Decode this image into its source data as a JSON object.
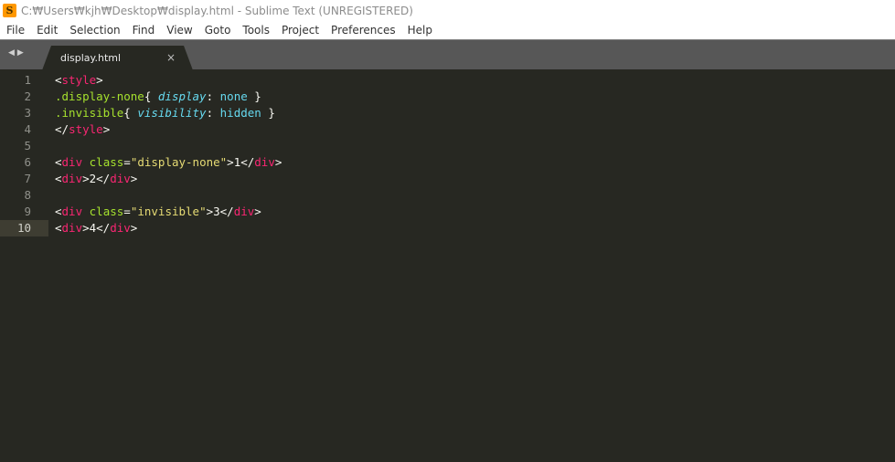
{
  "window": {
    "title": "C:₩Users₩kjh₩Desktop₩display.html - Sublime Text (UNREGISTERED)",
    "icon": "sublime-text-icon"
  },
  "menu": [
    "File",
    "Edit",
    "Selection",
    "Find",
    "View",
    "Goto",
    "Tools",
    "Project",
    "Preferences",
    "Help"
  ],
  "tabs": [
    {
      "label": "display.html",
      "close": "×",
      "active": true
    }
  ],
  "nav_arrows": "◀▶",
  "editor": {
    "active_line": 10,
    "colors": {
      "tag": "#f92672",
      "punct": "#f8f8f2",
      "attr": "#a6e22e",
      "string": "#e6db74",
      "property": "#66d9ef",
      "text": "#f8f8f2"
    },
    "lines": [
      {
        "n": "1",
        "tokens": [
          [
            "punct",
            "<"
          ],
          [
            "tag",
            "style"
          ],
          [
            "punct",
            ">"
          ]
        ]
      },
      {
        "n": "2",
        "tokens": [
          [
            "attr",
            ".display-none"
          ],
          [
            "punct",
            "{ "
          ],
          [
            "property-italic",
            "display"
          ],
          [
            "punct",
            ": "
          ],
          [
            "property",
            "none"
          ],
          [
            "punct",
            " }"
          ]
        ]
      },
      {
        "n": "3",
        "tokens": [
          [
            "attr",
            ".invisible"
          ],
          [
            "punct",
            "{ "
          ],
          [
            "property-italic",
            "visibility"
          ],
          [
            "punct",
            ": "
          ],
          [
            "property",
            "hidden"
          ],
          [
            "punct",
            " }"
          ]
        ]
      },
      {
        "n": "4",
        "tokens": [
          [
            "punct",
            "</"
          ],
          [
            "tag",
            "style"
          ],
          [
            "punct",
            ">"
          ]
        ]
      },
      {
        "n": "5",
        "tokens": []
      },
      {
        "n": "6",
        "tokens": [
          [
            "punct",
            "<"
          ],
          [
            "tag",
            "div"
          ],
          [
            "punct",
            " "
          ],
          [
            "attr",
            "class"
          ],
          [
            "punct",
            "="
          ],
          [
            "string",
            "\"display-none\""
          ],
          [
            "punct",
            ">1</"
          ],
          [
            "tag",
            "div"
          ],
          [
            "punct",
            ">"
          ]
        ]
      },
      {
        "n": "7",
        "tokens": [
          [
            "punct",
            "<"
          ],
          [
            "tag",
            "div"
          ],
          [
            "punct",
            ">2</"
          ],
          [
            "tag",
            "div"
          ],
          [
            "punct",
            ">"
          ]
        ]
      },
      {
        "n": "8",
        "tokens": []
      },
      {
        "n": "9",
        "tokens": [
          [
            "punct",
            "<"
          ],
          [
            "tag",
            "div"
          ],
          [
            "punct",
            " "
          ],
          [
            "attr",
            "class"
          ],
          [
            "punct",
            "="
          ],
          [
            "string",
            "\"invisible\""
          ],
          [
            "punct",
            ">3</"
          ],
          [
            "tag",
            "div"
          ],
          [
            "punct",
            ">"
          ]
        ]
      },
      {
        "n": "10",
        "tokens": [
          [
            "punct",
            "<"
          ],
          [
            "tag",
            "div"
          ],
          [
            "punct",
            ">4</"
          ],
          [
            "tag",
            "div"
          ],
          [
            "punct",
            ">"
          ]
        ]
      }
    ]
  }
}
